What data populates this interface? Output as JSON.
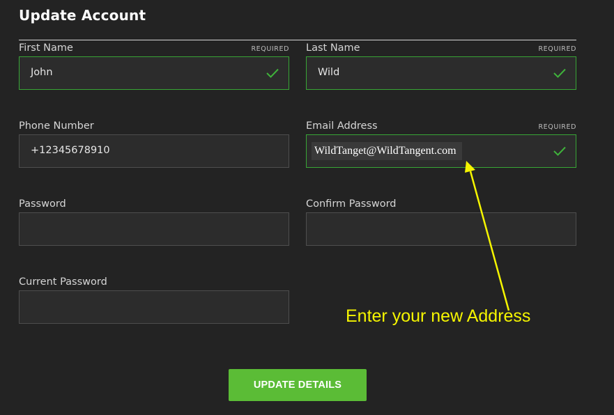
{
  "page": {
    "title": "Update Account"
  },
  "form": {
    "required_text": "REQUIRED",
    "first_name": {
      "label": "First Name",
      "value": "John"
    },
    "last_name": {
      "label": "Last Name",
      "value": "Wild"
    },
    "phone": {
      "label": "Phone Number",
      "value": "+12345678910"
    },
    "email": {
      "label": "Email Address",
      "value": "WildTanget@WildTangent.com"
    },
    "password": {
      "label": "Password",
      "value": ""
    },
    "confirm_password": {
      "label": "Confirm Password",
      "value": ""
    },
    "current_password": {
      "label": "Current Password",
      "value": ""
    },
    "submit_label": "UPDATE DETAILS"
  },
  "annotation": {
    "text": "Enter your new Address"
  },
  "colors": {
    "background": "#232323",
    "valid_border": "#38a636",
    "check": "#3fb33b",
    "button": "#5bbc36",
    "annotation": "#f5f500"
  },
  "icons": {
    "valid": "checkmark-icon",
    "pointer": "arrow-icon"
  }
}
